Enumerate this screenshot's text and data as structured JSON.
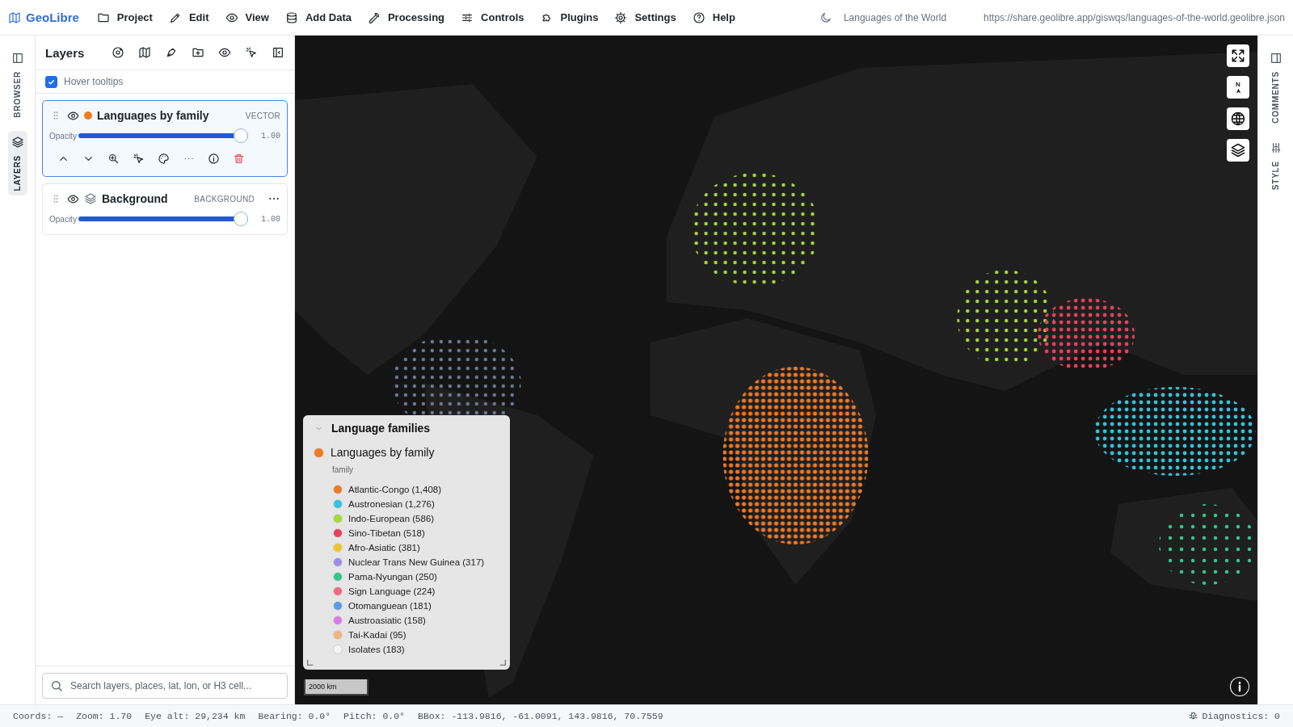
{
  "topbar": {
    "brand": "GeoLibre",
    "menu": [
      {
        "label": "Project"
      },
      {
        "label": "Edit"
      },
      {
        "label": "View"
      },
      {
        "label": "Add Data"
      },
      {
        "label": "Processing"
      },
      {
        "label": "Controls"
      },
      {
        "label": "Plugins"
      },
      {
        "label": "Settings"
      },
      {
        "label": "Help"
      }
    ],
    "project_title": "Languages of the World",
    "url": "https://share.geolibre.app/giswqs/languages-of-the-world.geolibre.json"
  },
  "left_rail": [
    {
      "label": "BROWSER",
      "selected": false
    },
    {
      "label": "LAYERS",
      "selected": true
    }
  ],
  "panel": {
    "title": "Layers",
    "hover_tooltips": {
      "label": "Hover tooltips",
      "checked": true
    },
    "layers": [
      {
        "kind": "vector",
        "name": "Languages by family",
        "type_label": "VECTOR",
        "color": "#f07a22",
        "visible": true,
        "selected": true,
        "opacity_label": "Opacity",
        "level": 1,
        "reading": "1.00"
      },
      {
        "kind": "background",
        "name": "Background",
        "type_label": "BACKGROUND",
        "visible": true,
        "selected": false,
        "opacity_label": "Opacity",
        "level": 1,
        "reading": "1.00"
      }
    ],
    "search": {
      "placeholder": "Search layers, places, lat, lon, or H3 cell..."
    }
  },
  "map": {
    "compass": "N",
    "scale": "2000 km",
    "legend": {
      "title": "Language families",
      "expanded": true,
      "layer": {
        "name": "Languages by family",
        "color": "#f07a22"
      },
      "field": "family",
      "items": [
        {
          "label": "Atlantic-Congo (1,408)",
          "color": "#f07a22"
        },
        {
          "label": "Austronesian (1,276)",
          "color": "#2ec6e0"
        },
        {
          "label": "Indo-European (586)",
          "color": "#a6d93a"
        },
        {
          "label": "Sino-Tibetan (518)",
          "color": "#e8405e"
        },
        {
          "label": "Afro-Asiatic (381)",
          "color": "#f2c52a"
        },
        {
          "label": "Nuclear Trans New Guinea (317)",
          "color": "#9b8ee8"
        },
        {
          "label": "Pama-Nyungan (250)",
          "color": "#2fc98e"
        },
        {
          "label": "Sign Language (224)",
          "color": "#f06a84"
        },
        {
          "label": "Otomanguean (181)",
          "color": "#5b9be8"
        },
        {
          "label": "Austroasiatic (158)",
          "color": "#d77be8"
        },
        {
          "label": "Tai-Kadai (95)",
          "color": "#f5b27a"
        },
        {
          "label": "Isolates (183)",
          "color": "#f4f4f4"
        }
      ]
    }
  },
  "right_rail": [
    {
      "label": "COMMENTS"
    },
    {
      "label": "STYLE"
    }
  ],
  "status_bar": {
    "items": [
      "Coords: —",
      "Zoom: 1.70",
      "Eye alt: 29,234 km",
      "Bearing: 0.0°",
      "Pitch: 0.0°",
      "BBox: -113.9816, -61.0091, 143.9816, 70.7559"
    ],
    "diagnostics": "Diagnostics: 0"
  }
}
